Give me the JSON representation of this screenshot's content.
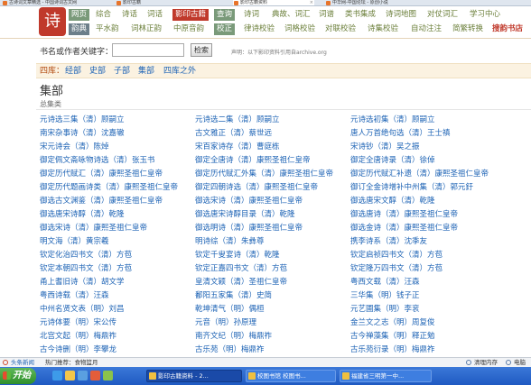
{
  "browser": {
    "tabs": [
      {
        "label": "古诗词文章精选 - 中国诗词古文网",
        "active": false
      },
      {
        "label": "影印古籍",
        "active": false
      },
      {
        "label": "影印古籍资料",
        "active": true
      },
      {
        "label": "中华网-中国论坛 - 原创小说",
        "active": false
      }
    ]
  },
  "header": {
    "logo": "诗",
    "nav_row1": [
      {
        "label": "网页",
        "style": "boxed"
      },
      {
        "label": "综合"
      },
      {
        "label": "诗话"
      },
      {
        "label": "词话"
      },
      {
        "label": "影印古籍",
        "style": "boxed"
      },
      {
        "label": "查询",
        "style": "boxed"
      },
      {
        "label": "诗词"
      },
      {
        "label": "典故、词汇"
      },
      {
        "label": "词谱"
      },
      {
        "label": "类书集成"
      },
      {
        "label": "诗词地图"
      },
      {
        "label": "对仗词汇"
      },
      {
        "label": "学习中心"
      }
    ],
    "nav_row2": [
      {
        "label": "韵典",
        "style": "boxed-dark"
      },
      {
        "label": "平水韵"
      },
      {
        "label": "词林正韵"
      },
      {
        "label": "中原音韵"
      },
      {
        "label": "校正",
        "style": "boxed"
      },
      {
        "label": "律诗校验"
      },
      {
        "label": "词格校验"
      },
      {
        "label": "对联校验"
      },
      {
        "label": "诗集校验"
      },
      {
        "label": "自动注注"
      },
      {
        "label": "简繁转换"
      },
      {
        "label": "搜韵书店",
        "style": "hl"
      }
    ]
  },
  "search": {
    "label": "书名或作者关键字：",
    "value": "",
    "placeholder": "",
    "button": "检索",
    "notice": "声明：以下影印资料引用自archive.org"
  },
  "breadcrumb": {
    "first": "四库：",
    "items": [
      "经部",
      "史部",
      "子部",
      "集部",
      "四库之外"
    ]
  },
  "section": {
    "title": "集部",
    "subtitle": "总集类"
  },
  "books": [
    [
      "元诗选三集（清）顾嗣立",
      "元诗选二集（清）顾嗣立",
      "元诗选初集（清）顾嗣立"
    ],
    [
      "南宋杂事诗（清）沈嘉辙",
      "古文雅正（清）蔡世远",
      "唐人万首绝句选（清）王士禛"
    ],
    [
      "宋元诗会（清）陈焯",
      "宋百家诗存（清）曹庭栋",
      "宋诗钞（清）吴之振"
    ],
    [
      "御定佩文斋咏物诗选（清）张玉书",
      "御定全唐诗（清）康熙圣祖仁皇帝",
      "御定全唐诗录（清）徐倬"
    ],
    [
      "御定历代赋汇（清）康熙圣祖仁皇帝",
      "御定历代赋汇外集（清）康熙圣祖仁皇帝",
      "御定历代赋汇补遗（清）康熙圣祖仁皇帝"
    ],
    [
      "御定历代题画诗类（清）康熙圣祖仁皇帝",
      "御定四朝诗选（清）康熙圣祖仁皇帝",
      "御订全金诗增补中州集（清）郭元釪"
    ],
    [
      "御选古文渊鉴（清）康熙圣祖仁皇帝",
      "御选宋诗（清）康熙圣祖仁皇帝",
      "御选唐宋文醇（清）乾隆"
    ],
    [
      "御选唐宋诗醇（清）乾隆",
      "御选唐宋诗醇目录（清）乾隆",
      "御选唐诗（清）康熙圣祖仁皇帝"
    ],
    [
      "御选宋诗（清）康熙圣祖仁皇帝",
      "御选明诗（清）康熙圣祖仁皇帝",
      "御选金诗（清）康熙圣祖仁皇帝"
    ],
    [
      "明文海（清）黄宗羲",
      "明诗综（清）朱彝尊",
      "携李诗系（清）沈季友"
    ],
    [
      "钦定化治四书文（清）方苞",
      "钦定千叟宴诗（清）乾隆",
      "钦定启祯四书文（清）方苞"
    ],
    [
      "钦定本朝四书文（清）方苞",
      "钦定正嘉四书文（清）方苞",
      "钦定隆万四书文（清）方苞"
    ],
    [
      "甬上耆旧诗（清）胡文学",
      "皇清文颖（清）圣祖仁皇帝",
      "粤西文载（清）汪森"
    ],
    [
      "粤西诗载（清）汪森",
      "鄱阳五家集（清）史简",
      "三华集（明）钱子正"
    ],
    [
      "中州名贤文表（明）刘昌",
      "乾坤清气（明）偶桓",
      "元艺圃集（明）李衮"
    ],
    [
      "元诗体要（明）宋公传",
      "元音（明）孙原理",
      "金兰文之志（明）周复俊"
    ],
    [
      "北宫文起（明）梅鼎祚",
      "南齐文纪（明）梅鼎祚",
      "古今禅藻集（明）释正勉"
    ],
    [
      "古今诗删（明）李攀龙",
      "古乐苑（明）梅鼎祚",
      "古乐苑衍录（明）梅鼎祚"
    ]
  ],
  "statusbar": {
    "left": "头条新闻",
    "left2": "热门推荐：食物篮月",
    "right1": "清理内存",
    "right2": "电脑"
  },
  "taskbar": {
    "start": "开始",
    "buttons": [
      {
        "label": "影印古籍资料 - 2...",
        "active": true
      },
      {
        "label": "校图书馆 校图书...",
        "active": false
      },
      {
        "label": "福建省三明第一中...",
        "active": false
      }
    ]
  }
}
